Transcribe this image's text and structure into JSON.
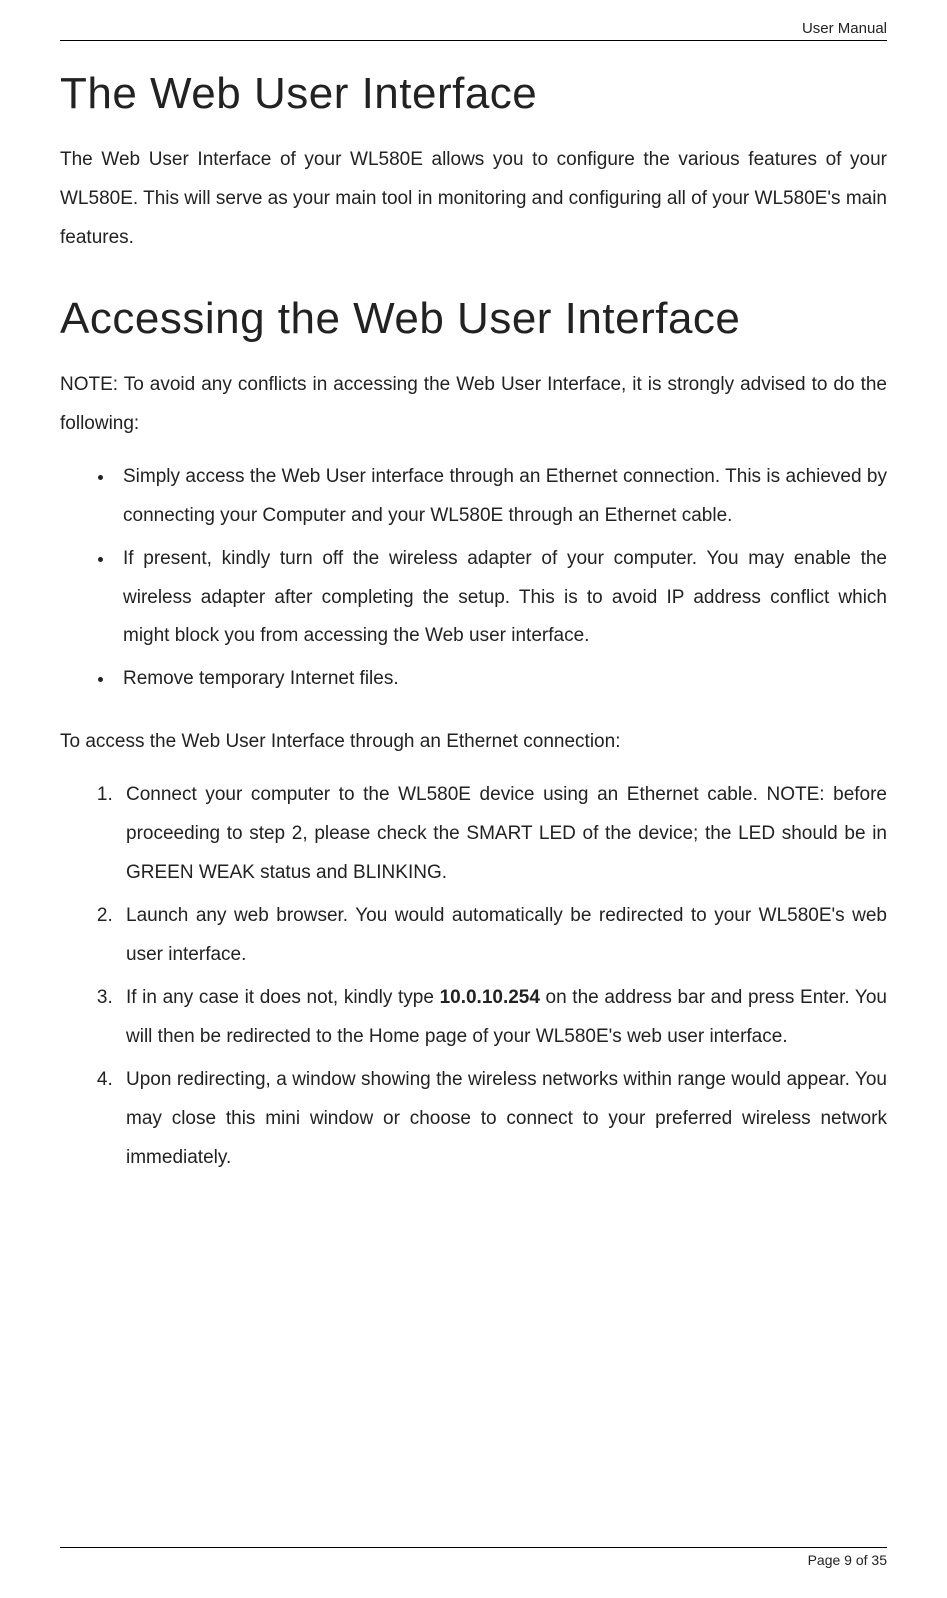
{
  "header": {
    "title": "User Manual"
  },
  "footer": {
    "text": "Page 9 of 35"
  },
  "sec1": {
    "heading": "The Web User Interface",
    "para1": "The Web User Interface of your WL580E allows you to configure the various features of your WL580E. This will serve as your main tool in monitoring and configuring all of your WL580E's main features."
  },
  "sec2": {
    "heading": "Accessing the Web User Interface",
    "note": "NOTE: To avoid any conflicts in accessing the Web User Interface, it is strongly advised to do the following:",
    "bullets": [
      "Simply access the Web User interface through an Ethernet connection. This is achieved by connecting your Computer and your WL580E through an Ethernet cable.",
      "If present, kindly turn off the wireless adapter of your computer. You may enable the wireless adapter after completing the setup. This is to avoid IP address conflict which might block you from accessing the Web user interface.",
      "Remove temporary Internet files."
    ],
    "intro2": "To access the Web User Interface through an Ethernet connection:",
    "step1": "Connect your computer to the WL580E device using an Ethernet cable. NOTE: before proceeding to step 2, please check the SMART LED of the device; the LED should be in GREEN WEAK status and BLINKING.",
    "step2": "Launch any web browser. You would automatically be redirected to your WL580E's web user interface.",
    "step3_a": "If in any case it does not, kindly type ",
    "step3_ip": "10.0.10.254",
    "step3_b": " on the address bar and press Enter. You will then be redirected to the Home page of your WL580E's web user interface.",
    "step4": "Upon redirecting, a window showing the wireless networks within range would appear. You may close this mini window or choose to connect to your preferred wireless network immediately."
  }
}
